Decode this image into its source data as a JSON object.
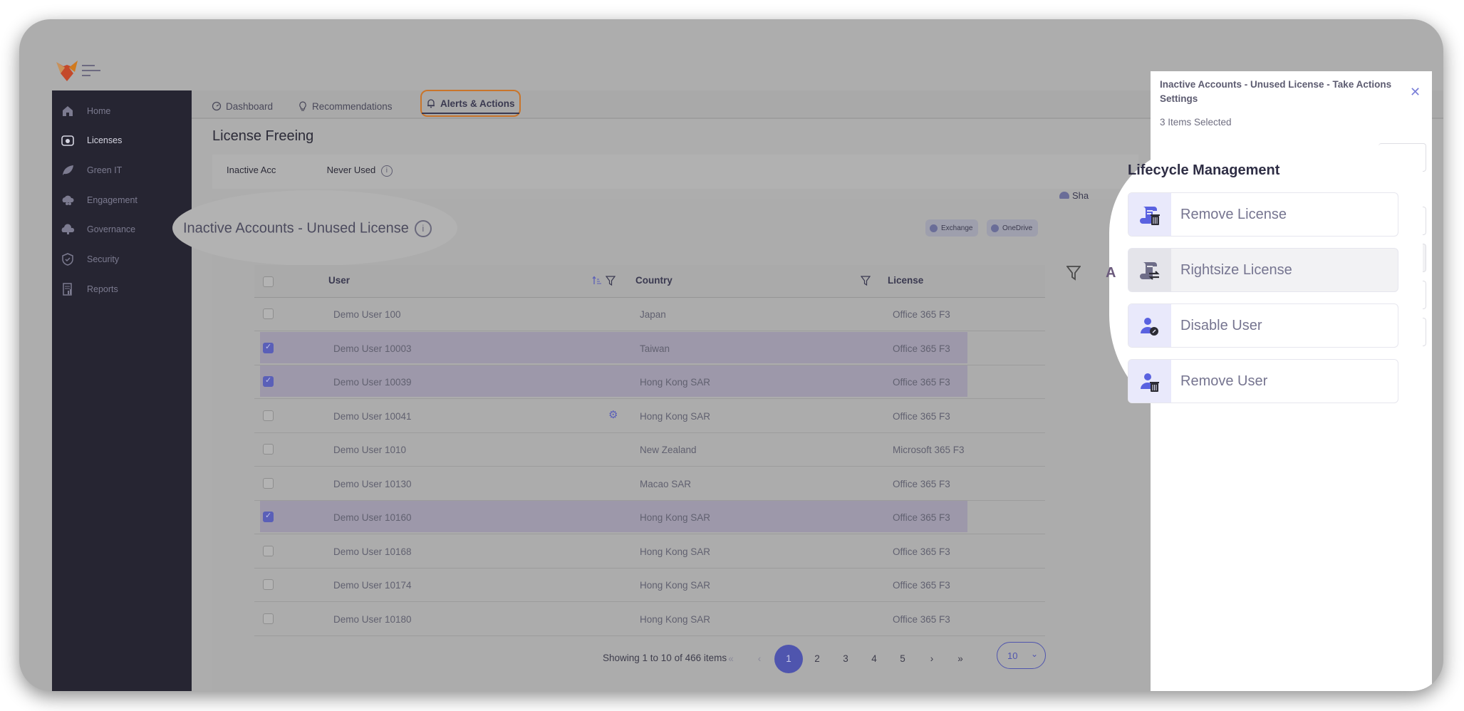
{
  "app": {
    "logo_icon": "fox-logo-icon",
    "menu_icon": "hamburger-icon"
  },
  "sidebar": {
    "items": [
      {
        "label": "Home",
        "icon": "home-icon",
        "active": false
      },
      {
        "label": "Licenses",
        "icon": "folder-gear-icon",
        "active": true
      },
      {
        "label": "Green IT",
        "icon": "leaf-icon",
        "active": false
      },
      {
        "label": "Engagement",
        "icon": "cloud-users-icon",
        "active": false
      },
      {
        "label": "Governance",
        "icon": "cloud-lock-icon",
        "active": false,
        "expandable": true
      },
      {
        "label": "Security",
        "icon": "shield-check-icon",
        "active": false
      },
      {
        "label": "Reports",
        "icon": "report-icon",
        "active": false
      }
    ]
  },
  "tabs": [
    {
      "label": "Dashboard",
      "icon": "gauge-icon",
      "active": false
    },
    {
      "label": "Recommendations",
      "icon": "lightbulb-icon",
      "active": false
    },
    {
      "label": "Alerts & Actions",
      "icon": "bell-icon",
      "active": true
    }
  ],
  "page": {
    "title": "License Freeing",
    "subtab_label": "Inactive Accounts - Unused License Never Used",
    "subtab_visible_left": "Inactive Acc",
    "subtab_visible_right": "Never Used",
    "share_chip": "Sha"
  },
  "section": {
    "title": "Inactive Accounts - Unused License",
    "filters": [
      {
        "label": "Exchange"
      },
      {
        "label": "OneDrive"
      }
    ]
  },
  "table": {
    "columns": [
      {
        "label": "User",
        "sortable": true,
        "filterable": true
      },
      {
        "label": "Country",
        "filterable": true
      },
      {
        "label": "License"
      }
    ],
    "rows": [
      {
        "user": "Demo User 100",
        "country": "Japan",
        "license": "Office 365 F3",
        "selected": false
      },
      {
        "user": "Demo User 10003",
        "country": "Taiwan",
        "license": "Office 365 F3",
        "selected": true
      },
      {
        "user": "Demo User 10039",
        "country": "Hong Kong SAR",
        "license": "Office 365 F3",
        "selected": true
      },
      {
        "user": "Demo User 10041",
        "country": "Hong Kong SAR",
        "license": "Office 365 F3",
        "selected": false,
        "badge": "gear-icon"
      },
      {
        "user": "Demo User 1010",
        "country": "New Zealand",
        "license": "Microsoft 365 F3",
        "selected": false
      },
      {
        "user": "Demo User 10130",
        "country": "Macao SAR",
        "license": "Office 365 F3",
        "selected": false
      },
      {
        "user": "Demo User 10160",
        "country": "Hong Kong SAR",
        "license": "Office 365 F3",
        "selected": true
      },
      {
        "user": "Demo User 10168",
        "country": "Hong Kong SAR",
        "license": "Office 365 F3",
        "selected": false
      },
      {
        "user": "Demo User 10174",
        "country": "Hong Kong SAR",
        "license": "Office 365 F3",
        "selected": false
      },
      {
        "user": "Demo User 10180",
        "country": "Hong Kong SAR",
        "license": "Office 365 F3",
        "selected": false
      }
    ]
  },
  "pagination": {
    "summary": "Showing 1 to 10 of 466 items",
    "first": "«",
    "prev": "‹",
    "pages": [
      "1",
      "2",
      "3",
      "4",
      "5"
    ],
    "current_page": "1",
    "next": "›",
    "last": "»",
    "page_size": "10"
  },
  "panel": {
    "title": "Inactive Accounts - Unused License - Take Actions Settings",
    "close_icon": "close-icon",
    "selected_count": "3 Items Selected",
    "section_title": "Lifecycle Management",
    "actions": [
      {
        "label": "Remove License",
        "icon": "license-remove-icon"
      },
      {
        "label": "Rightsize License",
        "icon": "license-swap-icon"
      },
      {
        "label": "Disable User",
        "icon": "user-disable-icon"
      },
      {
        "label": "Remove User",
        "icon": "user-remove-icon"
      }
    ]
  },
  "colors": {
    "accent": "#4f55ae",
    "sidebar_bg": "#262532",
    "active_tab_outline": "#c9752b",
    "selected_row": "#9d98aa"
  }
}
